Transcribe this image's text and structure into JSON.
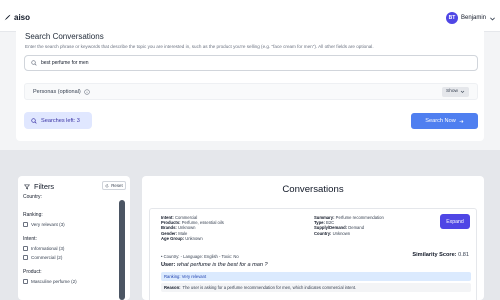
{
  "app": {
    "logo_text": "aiso",
    "user_initials": "BT",
    "user_name": "Benjamin"
  },
  "search": {
    "title": "Search Conversations",
    "description": "Enter the search phrase or keywords that describe the topic you are interested in, such as the product you're selling (e.g. \"face cream for men\"). All other fields are optional.",
    "query_value": "best perfume for men",
    "personas_label": "Personas (optional)",
    "show_label": "Show",
    "searches_left_label": "Searches left: 3",
    "search_now_label": "Search Now"
  },
  "filters": {
    "title": "Filters",
    "reset_label": "Reset",
    "country_heading": "Country:",
    "ranking_heading": "Ranking:",
    "ranking_options": [
      "Very relevant (3)"
    ],
    "intent_heading": "Intent:",
    "intent_options": [
      "Informational (3)",
      "Commercial (2)"
    ],
    "product_heading": "Product:",
    "product_options": [
      "Masculine perfume (2)"
    ]
  },
  "conversations": {
    "title": "Conversations",
    "card": {
      "meta_left": [
        {
          "key": "Intent:",
          "value": "Commercial"
        },
        {
          "key": "Products:",
          "value": "Perfume, essential oils"
        },
        {
          "key": "Brands:",
          "value": "Unknown"
        },
        {
          "key": "Gender:",
          "value": "Male"
        },
        {
          "key": "Age Group:",
          "value": "Unknown"
        }
      ],
      "meta_right": [
        {
          "key": "Summary:",
          "value": "Perfume recommendation"
        },
        {
          "key": "Type:",
          "value": "B2C"
        },
        {
          "key": "Supply/Demand:",
          "value": "Demand"
        },
        {
          "key": "Country:",
          "value": "Unknown"
        }
      ],
      "expand_label": "Expand",
      "context_line": "• Country: - Language: English - Toxic: No",
      "similarity_label": "Similarity Score:",
      "similarity_value": "0.81",
      "user_label": "User:",
      "user_question": "what perfume is the best for a man ?",
      "ranking_text": "Ranking: Very relevant",
      "reason_label": "Reason:",
      "reason_text": "The user is asking for a perfume recommendation for men, which indicates commercial intent."
    }
  },
  "colors": {
    "primary": "#4f46e5",
    "search_button": "#4f7ff0",
    "ranking_bg": "#dbeafe"
  }
}
